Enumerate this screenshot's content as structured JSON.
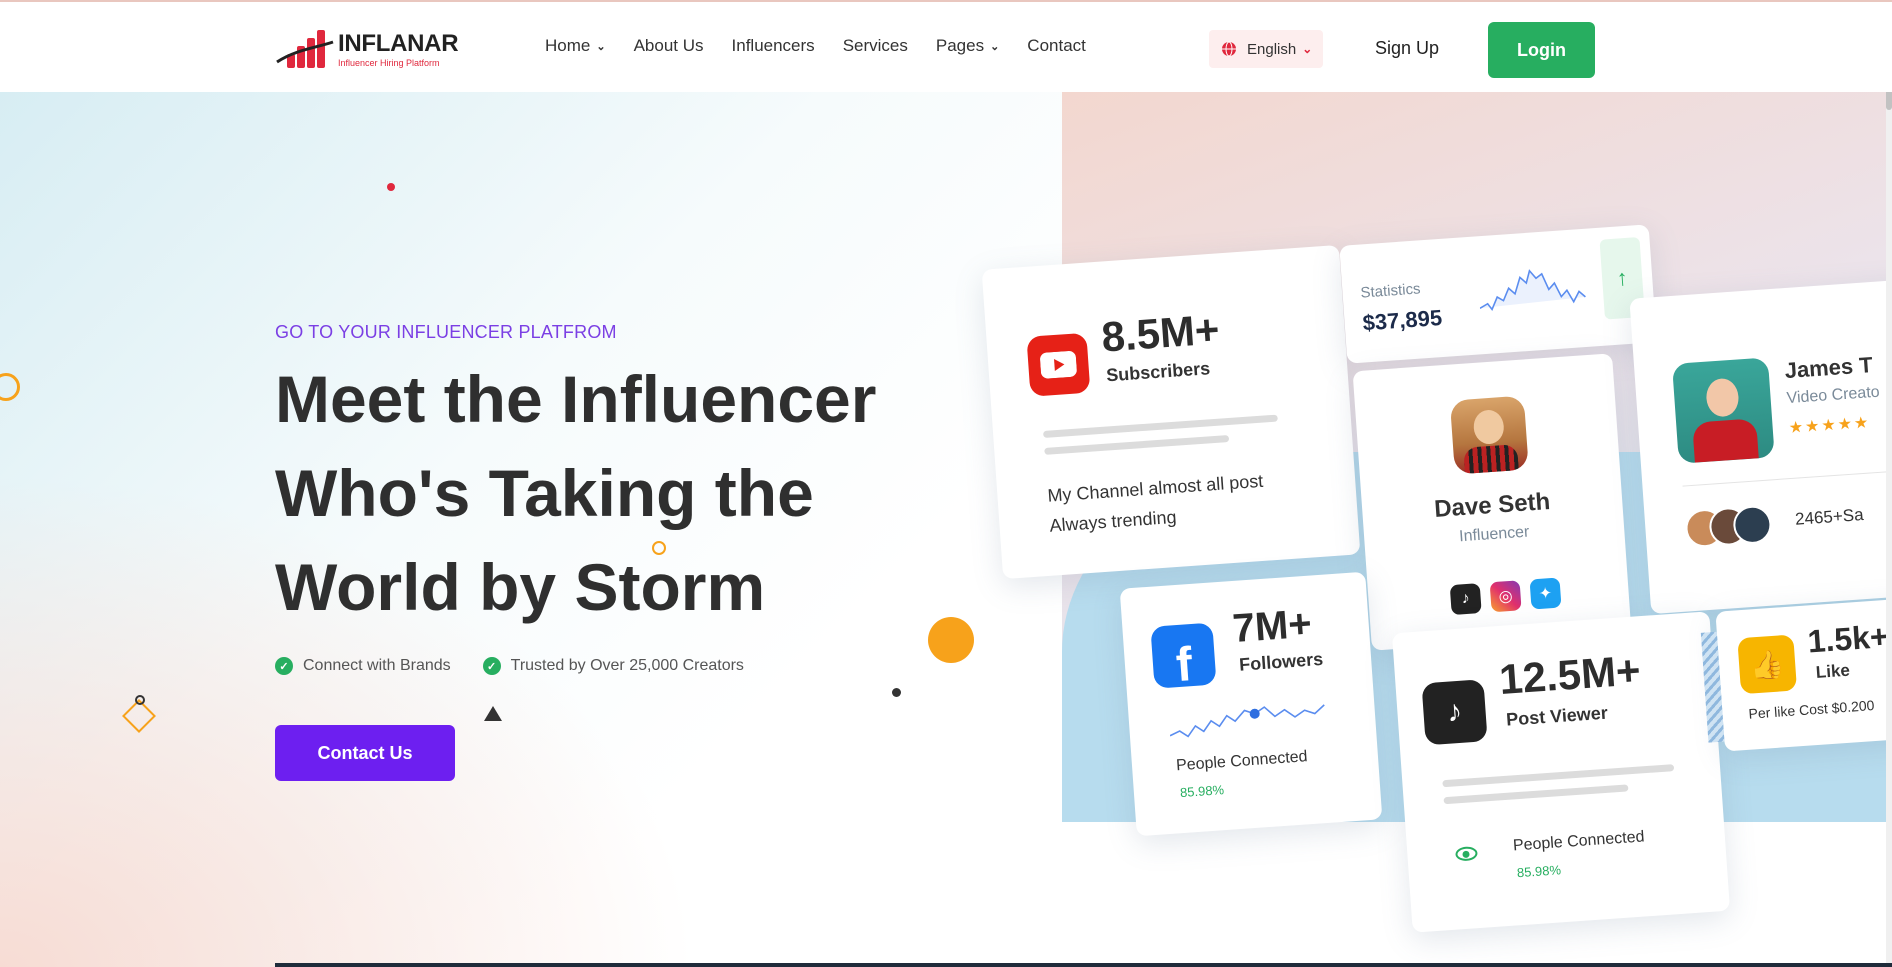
{
  "brand": {
    "name": "INFLANAR",
    "tagline": "Influencer Hiring Platform"
  },
  "nav": {
    "items": [
      {
        "label": "Home",
        "has_dropdown": true
      },
      {
        "label": "About Us",
        "has_dropdown": false
      },
      {
        "label": "Influencers",
        "has_dropdown": false
      },
      {
        "label": "Services",
        "has_dropdown": false
      },
      {
        "label": "Pages",
        "has_dropdown": true
      },
      {
        "label": "Contact",
        "has_dropdown": false
      }
    ],
    "language": "English",
    "signup_label": "Sign Up",
    "login_label": "Login"
  },
  "hero": {
    "kicker": "GO TO YOUR INFLUENCER PLATFROM",
    "headline": [
      "Meet the Influencer",
      "Who's Taking the",
      "World by Storm"
    ],
    "features": [
      "Connect with Brands",
      "Trusted by Over 25,000 Creators"
    ],
    "cta_label": "Contact Us"
  },
  "cards": {
    "youtube": {
      "value": "8.5M+",
      "label": "Subscribers",
      "text_line1": "My Channel almost all post",
      "text_line2": "Always trending"
    },
    "statistics": {
      "label": "Statistics",
      "value": "$37,895"
    },
    "profile": {
      "name": "Dave Seth",
      "role": "Influencer"
    },
    "featured": {
      "name": "James T",
      "role": "Video Creato",
      "rating": 5,
      "count": "2465+Sa"
    },
    "facebook": {
      "value": "7M+",
      "label": "Followers",
      "people_label": "People Connected",
      "percent": "85.98%"
    },
    "tiktok": {
      "value": "12.5M+",
      "label": "Post Viewer",
      "people_label": "People Connected",
      "percent": "85.98%"
    },
    "likes": {
      "value": "1.5k+",
      "label": "Like",
      "cost": "Per like Cost $0.200"
    }
  },
  "colors": {
    "accent_purple": "#6d1ff0",
    "login_green": "#27ae60",
    "brand_red": "#e0283d"
  }
}
